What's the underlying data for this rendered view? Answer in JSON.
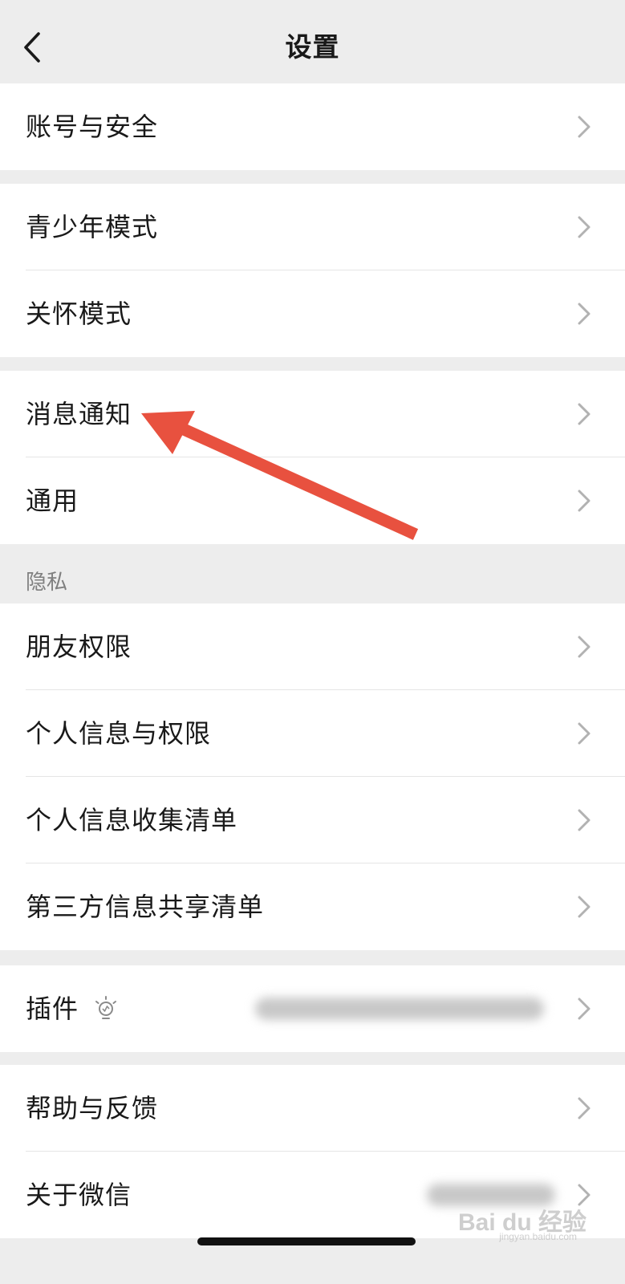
{
  "header": {
    "title": "设置"
  },
  "groups": [
    {
      "items": [
        {
          "label": "账号与安全"
        }
      ]
    },
    {
      "items": [
        {
          "label": "青少年模式"
        },
        {
          "label": "关怀模式"
        }
      ]
    },
    {
      "items": [
        {
          "label": "消息通知"
        },
        {
          "label": "通用"
        }
      ]
    },
    {
      "section_title": "隐私",
      "items": [
        {
          "label": "朋友权限"
        },
        {
          "label": "个人信息与权限"
        },
        {
          "label": "个人信息收集清单"
        },
        {
          "label": "第三方信息共享清单"
        }
      ]
    },
    {
      "items": [
        {
          "label": "插件",
          "icon": "lightbulb-icon"
        }
      ]
    },
    {
      "items": [
        {
          "label": "帮助与反馈"
        },
        {
          "label": "关于微信"
        }
      ]
    }
  ],
  "annotation": {
    "arrow_color": "#e8513f",
    "points_to": "消息通知"
  },
  "watermark": {
    "brand": "Bai du 经验",
    "domain": "jingyan.baidu.com"
  },
  "colors": {
    "background": "#ededed",
    "cell": "#ffffff",
    "text": "#191919",
    "secondary_text": "#7f7f7f",
    "chevron": "#b2b2b2"
  }
}
